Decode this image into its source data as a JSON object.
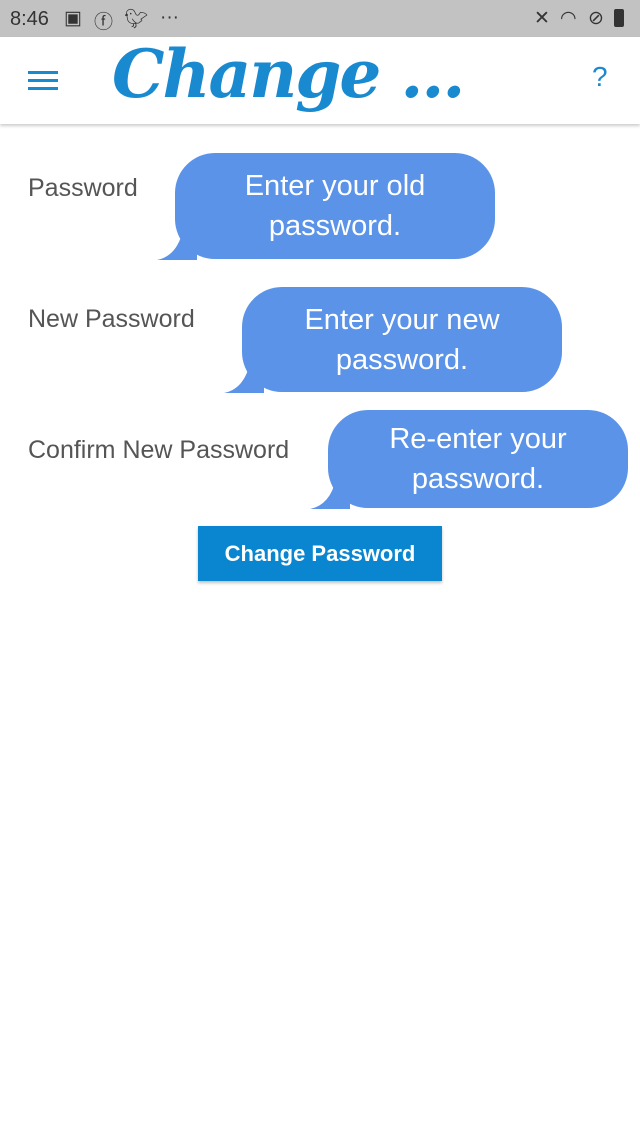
{
  "status_bar": {
    "time": "8:46",
    "left_icons": [
      "image-icon",
      "facebook-icon",
      "twitter-icon",
      "more-icon"
    ],
    "right_icons": [
      "mute-icon",
      "wifi-icon",
      "block-icon",
      "battery-icon"
    ]
  },
  "header": {
    "title": "Change ...",
    "help": "?"
  },
  "form": {
    "fields": [
      {
        "label": "Password",
        "hint": "Enter your old password."
      },
      {
        "label": "New Password",
        "hint": "Enter your new password."
      },
      {
        "label": "Confirm New Password",
        "hint": "Re-enter your password."
      }
    ],
    "submit_label": "Change Password"
  },
  "colors": {
    "accent": "#1a8ad0",
    "bubble": "#5a93e8",
    "button": "#0a85d0"
  }
}
